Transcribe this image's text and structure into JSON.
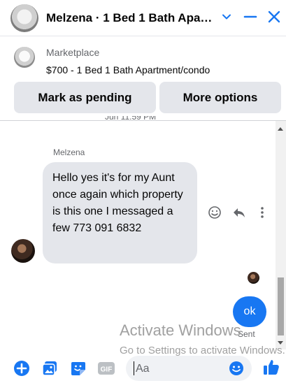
{
  "header": {
    "title": "Melzena · 1 Bed 1 Bath Apa…",
    "icons": [
      "chevron-down-icon",
      "minimize-icon",
      "close-icon"
    ]
  },
  "marketplace": {
    "label": "Marketplace",
    "listing": "$700 - 1 Bed 1 Bath Apartment/condo",
    "mark_pending_label": "Mark as pending",
    "more_options_label": "More options"
  },
  "conversation": {
    "partial_timestamp": "Jun 11:59 PM",
    "sender_name": "Melzena",
    "incoming_message": "Hello yes it's for my Aunt once again which property is this one I messaged a few 773 091 6832",
    "outgoing_message": "ok",
    "status": "Sent"
  },
  "watermark": {
    "line1": "Activate Windows",
    "line2": "Go to Settings to activate Windows."
  },
  "composer": {
    "placeholder": "Aa",
    "icons": [
      "plus-icon",
      "photo-icon",
      "sticker-icon",
      "gif-icon",
      "emoji-icon",
      "like-icon"
    ]
  },
  "colors": {
    "accent": "#1877f2",
    "bubble_incoming": "#e4e6eb",
    "secondary_text": "#65676b"
  }
}
